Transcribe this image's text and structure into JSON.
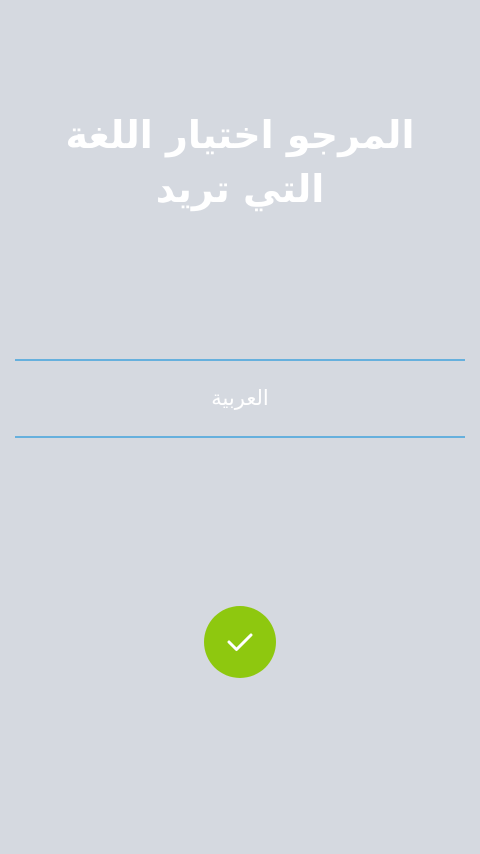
{
  "header": {
    "title": "المرجو اختيار اللغة التي تريد"
  },
  "language_picker": {
    "selected": "العربية"
  },
  "confirm": {
    "icon": "check-icon"
  },
  "colors": {
    "background": "#d5d9e0",
    "divider": "#66b0dd",
    "confirm_button": "#8ec80f",
    "text": "#ffffff"
  }
}
